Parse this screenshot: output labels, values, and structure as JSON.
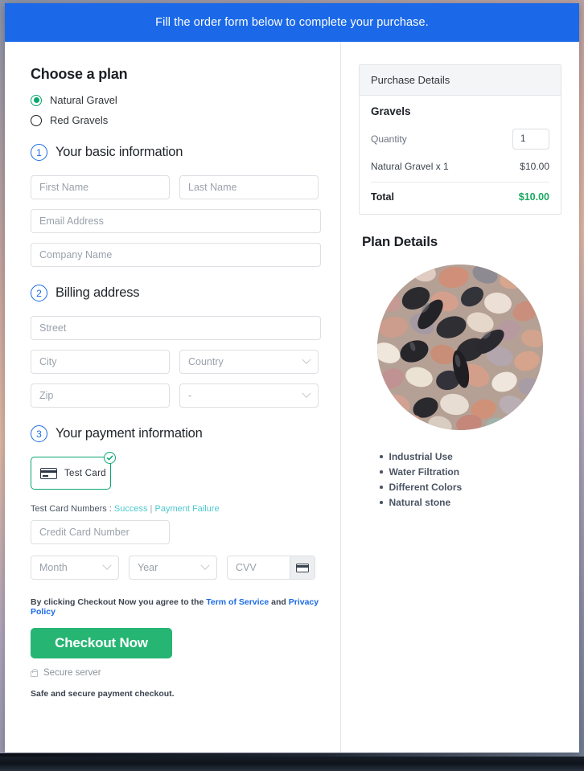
{
  "banner": {
    "text": "Fill the order form below to complete your purchase."
  },
  "plan": {
    "heading": "Choose a plan",
    "options": [
      {
        "label": "Natural Gravel",
        "selected": true
      },
      {
        "label": "Red Gravels",
        "selected": false
      }
    ]
  },
  "steps": {
    "basic": {
      "number": "1",
      "title": "Your basic information"
    },
    "billing": {
      "number": "2",
      "title": "Billing address"
    },
    "payment": {
      "number": "3",
      "title": "Your payment information"
    }
  },
  "basic_fields": {
    "first_name": "First Name",
    "last_name": "Last Name",
    "email": "Email Address",
    "company": "Company Name"
  },
  "billing_fields": {
    "street": "Street",
    "city": "City",
    "country": "Country",
    "zip": "Zip",
    "state": "-"
  },
  "payment": {
    "card_tile_label": "Test  Card",
    "test_numbers_prefix": "Test Card Numbers : ",
    "link_success": "Success",
    "link_separator": " | ",
    "link_failure": "Payment Failure",
    "credit_card_number": "Credit Card Number",
    "month": "Month",
    "year": "Year",
    "cvv": "CVV"
  },
  "terms": {
    "prefix": "By clicking Checkout Now you agree to the ",
    "tos": "Term of Service",
    "middle": " and ",
    "privacy": "Privacy Policy"
  },
  "actions": {
    "checkout": "Checkout Now",
    "secure_server": "Secure server",
    "safe_note": "Safe and secure payment checkout."
  },
  "purchase": {
    "header": "Purchase Details",
    "product_title": "Gravels",
    "quantity_label": "Quantity",
    "quantity_value": "1",
    "line_item_label": "Natural Gravel x 1",
    "line_item_price": "$10.00",
    "total_label": "Total",
    "total_value": "$10.00"
  },
  "plan_details": {
    "title": "Plan Details",
    "image_alt": "gravel-stones-photo",
    "features": [
      "Industrial Use",
      "Water Filtration",
      "Different Colors",
      "Natural stone"
    ]
  },
  "colors": {
    "banner_blue": "#1b69e8",
    "accent_green": "#0aa66e",
    "checkout_green": "#26b573",
    "step_blue": "#1b6ae5",
    "link_teal": "#4ec9cf",
    "total_green": "#1aa860"
  }
}
